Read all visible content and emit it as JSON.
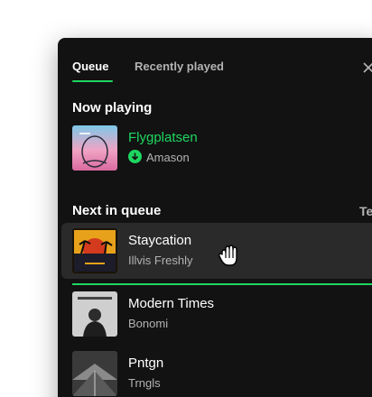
{
  "tabs": [
    {
      "label": "Queue",
      "active": true
    },
    {
      "label": "Recently played",
      "active": false
    }
  ],
  "close_icon": "close-icon",
  "now_playing": {
    "heading": "Now playing",
    "track": {
      "title": "Flygplatsen",
      "artist": "Amason",
      "downloaded": true
    }
  },
  "queue": {
    "heading": "Next in queue",
    "aside": "Te",
    "tracks": [
      {
        "title": "Staycation",
        "artist": "Illvis Freshly",
        "hovered": true
      },
      {
        "title": "Modern Times",
        "artist": "Bonomi"
      },
      {
        "title": "Pntgn",
        "artist": "Trngls"
      }
    ]
  },
  "colors": {
    "background": "#121212",
    "accent": "#1ed760",
    "text_primary": "#ffffff",
    "text_secondary": "#b3b3b3",
    "row_hover": "#2a2a2a"
  }
}
